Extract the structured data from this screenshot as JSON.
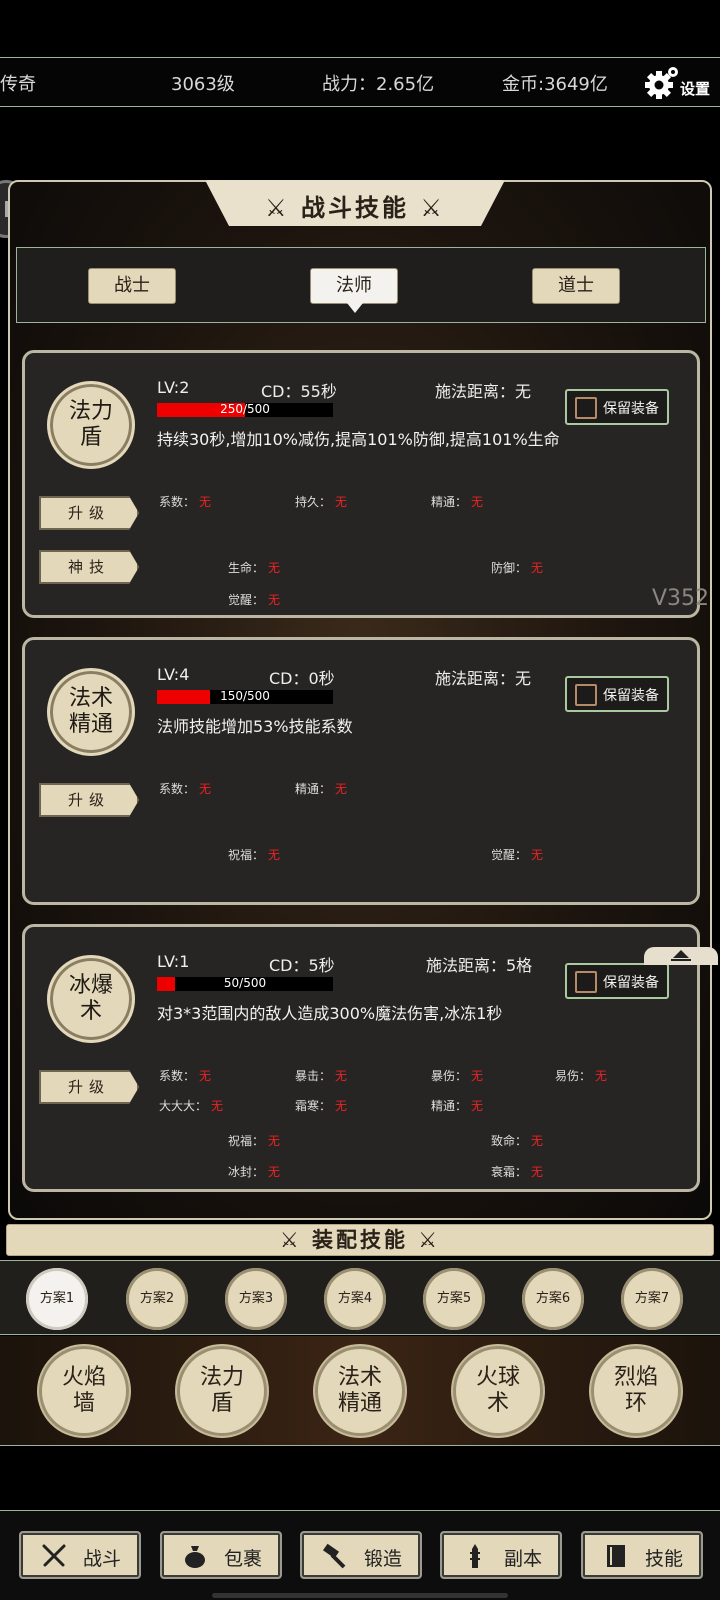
{
  "topbar": {
    "title": "传奇",
    "level": "3063级",
    "power": "战力：2.65亿",
    "gold": "金币:3649亿",
    "settings_label": "设置"
  },
  "panel": {
    "title": "战斗技能",
    "version": "V352"
  },
  "class_tabs": [
    {
      "label": "战士",
      "active": false
    },
    {
      "label": "法师",
      "active": true
    },
    {
      "label": "道士",
      "active": false
    }
  ],
  "skills": [
    {
      "name": "法力盾",
      "lv": "LV:2",
      "cd": "CD：55秒",
      "range": "施法距离：无",
      "progress_text": "250/500",
      "progress": 0.5,
      "desc": "持续30秒,增加10%减伤,提高101%防御,提高101%生命",
      "keep_label": "保留装备",
      "upgrade_label": "升级",
      "god_label": "神技",
      "stats": [
        {
          "label": "系数：",
          "value": "无"
        },
        {
          "label": "持久：",
          "value": "无"
        },
        {
          "label": "精通：",
          "value": "无"
        },
        {
          "label": "生命：",
          "value": "无"
        },
        {
          "label": "防御：",
          "value": "无"
        },
        {
          "label": "觉醒：",
          "value": "无"
        }
      ]
    },
    {
      "name": "法术精通",
      "lv": "LV:4",
      "cd": "CD：0秒",
      "range": "施法距离：无",
      "progress_text": "150/500",
      "progress": 0.3,
      "desc": "法师技能增加53%技能系数",
      "keep_label": "保留装备",
      "upgrade_label": "升级",
      "stats": [
        {
          "label": "系数：",
          "value": "无"
        },
        {
          "label": "精通：",
          "value": "无"
        },
        {
          "label": "祝福：",
          "value": "无"
        },
        {
          "label": "觉醒：",
          "value": "无"
        }
      ]
    },
    {
      "name": "冰爆术",
      "lv": "LV:1",
      "cd": "CD：5秒",
      "range": "施法距离：5格",
      "progress_text": "50/500",
      "progress": 0.1,
      "desc": "对3*3范围内的敌人造成300%魔法伤害,冰冻1秒",
      "keep_label": "保留装备",
      "upgrade_label": "升级",
      "stats": [
        {
          "label": "系数：",
          "value": "无"
        },
        {
          "label": "暴击：",
          "value": "无"
        },
        {
          "label": "暴伤：",
          "value": "无"
        },
        {
          "label": "易伤：",
          "value": "无"
        },
        {
          "label": "大大大：",
          "value": "无"
        },
        {
          "label": "霜寒：",
          "value": "无"
        },
        {
          "label": "精通：",
          "value": "无"
        },
        {
          "label": "祝福：",
          "value": "无"
        },
        {
          "label": "致命：",
          "value": "无"
        },
        {
          "label": "冰封：",
          "value": "无"
        },
        {
          "label": "衰霜：",
          "value": "无"
        }
      ]
    }
  ],
  "equip": {
    "title": "装配技能",
    "plans": [
      "方案1",
      "方案2",
      "方案3",
      "方案4",
      "方案5",
      "方案6",
      "方案7"
    ],
    "equipped": [
      "火焰墙",
      "法力盾",
      "法术精通",
      "火球术",
      "烈焰环"
    ]
  },
  "nav": [
    {
      "label": "战斗",
      "icon": "crossed-swords-icon"
    },
    {
      "label": "包裹",
      "icon": "bag-icon"
    },
    {
      "label": "锻造",
      "icon": "hammer-icon"
    },
    {
      "label": "副本",
      "icon": "tower-icon"
    },
    {
      "label": "技能",
      "icon": "book-icon"
    }
  ],
  "colors": {
    "accent_beige": "#e4d8bb",
    "border_green": "#9bb49a",
    "value_red": "#e22222",
    "progress_red": "#ee0000"
  }
}
